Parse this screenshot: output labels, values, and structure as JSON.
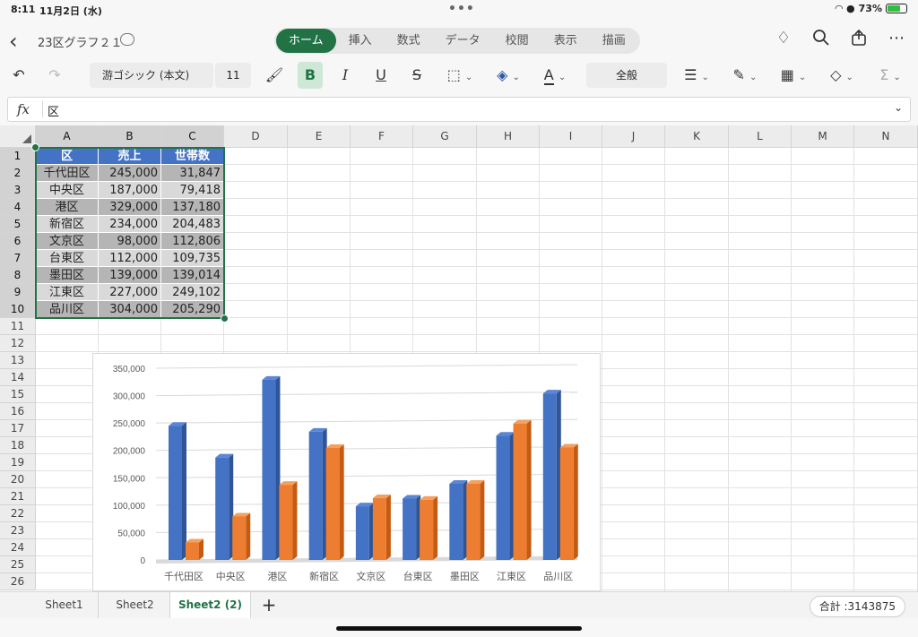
{
  "status": {
    "time": "8:11",
    "date": "11月2日 (水)",
    "dots": "•••",
    "battery": "73%",
    "battery_level": 0.73
  },
  "title": {
    "doc_name": "23区グラフ２１"
  },
  "tabs": [
    "ホーム",
    "挿入",
    "数式",
    "データ",
    "校閲",
    "表示",
    "描画"
  ],
  "active_tab": 0,
  "ribbon": {
    "font": "游ゴシック (本文)",
    "size": "11",
    "number_format": "全般",
    "bold_label": "B",
    "italic_label": "I",
    "underline_label": "U",
    "strike_label": "S"
  },
  "formula": {
    "fx_label": "fx",
    "value": "区"
  },
  "columns": [
    "A",
    "B",
    "C",
    "D",
    "E",
    "F",
    "G",
    "H",
    "I",
    "J",
    "K",
    "L",
    "M",
    "N"
  ],
  "rows": [
    "1",
    "2",
    "3",
    "4",
    "5",
    "6",
    "7",
    "8",
    "9",
    "10",
    "11",
    "12",
    "13",
    "14",
    "15",
    "16",
    "17",
    "18",
    "19",
    "20",
    "21",
    "22",
    "23",
    "24",
    "25",
    "26"
  ],
  "table": {
    "headers": [
      "区",
      "売上",
      "世帯数"
    ],
    "rows": [
      [
        "千代田区",
        "245,000",
        "31,847"
      ],
      [
        "中央区",
        "187,000",
        "79,418"
      ],
      [
        "港区",
        "329,000",
        "137,180"
      ],
      [
        "新宿区",
        "234,000",
        "204,483"
      ],
      [
        "文京区",
        "98,000",
        "112,806"
      ],
      [
        "台東区",
        "112,000",
        "109,735"
      ],
      [
        "墨田区",
        "139,000",
        "139,014"
      ],
      [
        "江東区",
        "227,000",
        "249,102"
      ],
      [
        "品川区",
        "304,000",
        "205,290"
      ]
    ]
  },
  "chart_data": {
    "type": "bar",
    "categories": [
      "千代田区",
      "中央区",
      "港区",
      "新宿区",
      "文京区",
      "台東区",
      "墨田区",
      "江東区",
      "品川区"
    ],
    "series": [
      {
        "values": [
          245000,
          187000,
          329000,
          234000,
          98000,
          112000,
          139000,
          227000,
          304000
        ],
        "color": "#4472c4"
      },
      {
        "values": [
          31847,
          79418,
          137180,
          204483,
          112806,
          109735,
          139014,
          249102,
          205290
        ],
        "color": "#ed7d31"
      }
    ],
    "yticks": [
      "0",
      "50,000",
      "100,000",
      "150,000",
      "200,000",
      "250,000",
      "300,000",
      "350,000"
    ],
    "ylim": [
      0,
      350000
    ],
    "grid": true
  },
  "sheets": [
    "Sheet1",
    "Sheet2",
    "Sheet2 (2)"
  ],
  "active_sheet": 2,
  "sum": {
    "label": "合計 :3143875"
  }
}
